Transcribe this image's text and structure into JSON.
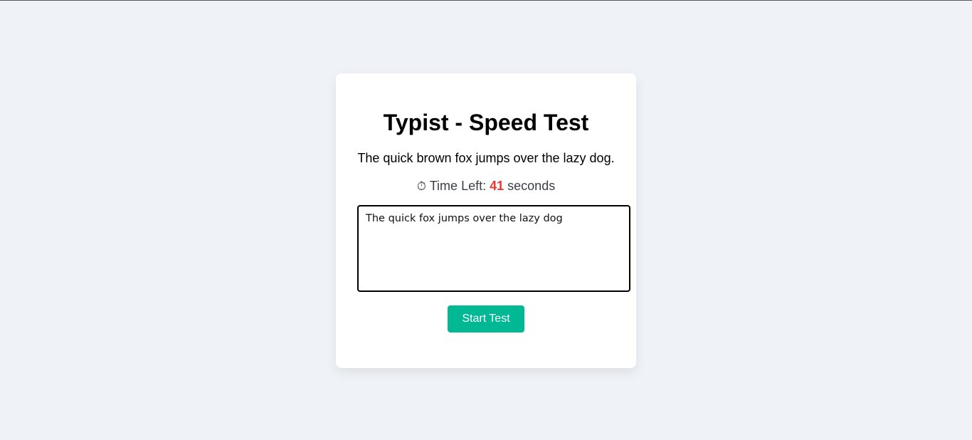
{
  "app": {
    "title": "Typist - Speed Test"
  },
  "test": {
    "prompt_text": "The quick brown fox jumps over the lazy dog.",
    "timer_icon": "⏱",
    "timer_label": "Time Left:",
    "time_left": "41",
    "timer_unit": "seconds",
    "typed_text": "The quick fox jumps over the lazy dog",
    "start_button_label": "Start Test"
  },
  "colors": {
    "background": "#eff3f8",
    "card": "#ffffff",
    "accent_button": "#00b894",
    "timer_count": "#e53935"
  }
}
